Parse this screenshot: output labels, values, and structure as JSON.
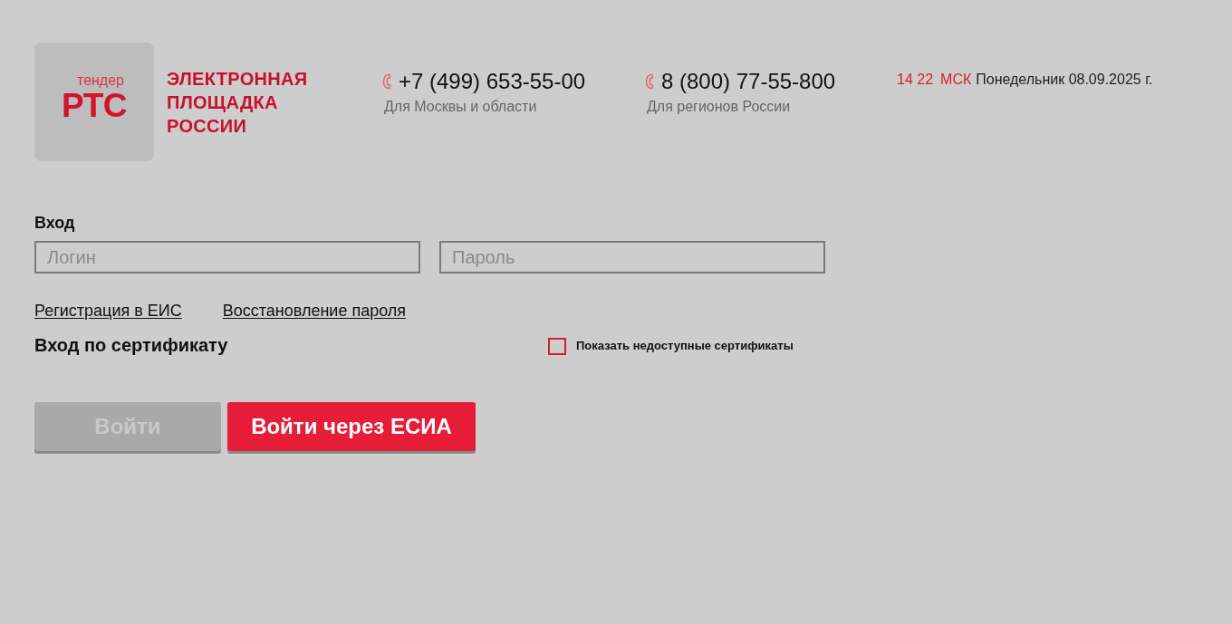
{
  "logo": {
    "small_text": "тендер",
    "mark": "РТС",
    "title_lines": [
      "ЭЛЕКТРОННАЯ",
      "ПЛОЩАДКА",
      "РОССИИ"
    ]
  },
  "phones": [
    {
      "number": "+7 (499) 653-55-00",
      "caption": "Для Москвы и области"
    },
    {
      "number": "8 (800) 77-55-800",
      "caption": "Для регионов России"
    }
  ],
  "clock": {
    "time": "14 22",
    "zone": "МСК",
    "date": "Понедельник 08.09.2025 г."
  },
  "login_form": {
    "title": "Вход",
    "fields": [
      {
        "placeholder": "Логин"
      },
      {
        "placeholder": "Пароль"
      }
    ],
    "links": [
      "Регистрация в ЕИС",
      "Восстановление пароля"
    ],
    "certificate_title": "Вход по сертификату",
    "show_unavailable": {
      "label": "Показать недоступные сертификаты",
      "checked": false
    },
    "buttons": [
      {
        "label": "Войти",
        "kind": "login",
        "disabled": true
      },
      {
        "label": "Войти через ЕСИА",
        "kind": "esia",
        "disabled": false
      }
    ]
  }
}
